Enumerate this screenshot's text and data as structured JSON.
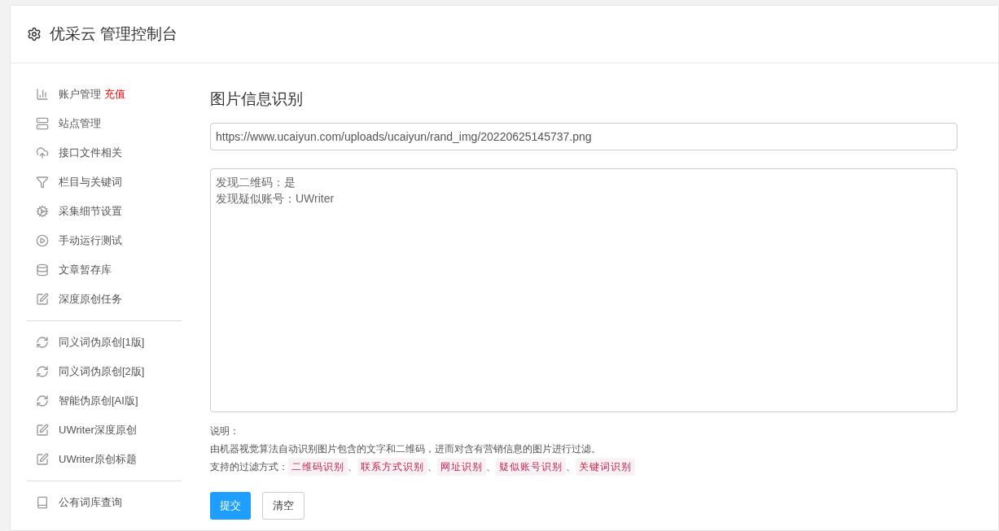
{
  "header": {
    "title": "优采云 管理控制台"
  },
  "sidebar": {
    "groups": [
      {
        "items": [
          {
            "label": "账户管理",
            "badge": "充值"
          },
          {
            "label": "站点管理"
          },
          {
            "label": "接口文件相关"
          },
          {
            "label": "栏目与关键词"
          },
          {
            "label": "采集细节设置"
          },
          {
            "label": "手动运行测试"
          },
          {
            "label": "文章暂存库"
          },
          {
            "label": "深度原创任务"
          }
        ]
      },
      {
        "items": [
          {
            "label": "同义词伪原创[1版]"
          },
          {
            "label": "同义词伪原创[2版]"
          },
          {
            "label": "智能伪原创[AI版]"
          },
          {
            "label": "UWriter深度原创"
          },
          {
            "label": "UWriter原创标题"
          }
        ]
      },
      {
        "items": [
          {
            "label": "公有词库查询"
          }
        ]
      }
    ]
  },
  "main": {
    "title": "图片信息识别",
    "url_field": {
      "value": "https://www.ucaiyun.com/uploads/ucaiyun/rand_img/20220625145737.png"
    },
    "result_lines": [
      "发现二维码：是",
      "发现疑似账号：UWriter"
    ],
    "note_title": "说明：",
    "note_text": "由机器视觉算法自动识别图片包含的文字和二维码，进而对含有营销信息的图片进行过滤。",
    "filters_label": "支持的过滤方式：",
    "filters": [
      "二维码识别",
      "联系方式识别",
      "网址识别",
      "疑似账号识别",
      "关键词识别"
    ],
    "separator": "、",
    "buttons": [
      {
        "kind": "primary",
        "label": "提交"
      },
      {
        "kind": "default",
        "label": "清空"
      }
    ]
  }
}
